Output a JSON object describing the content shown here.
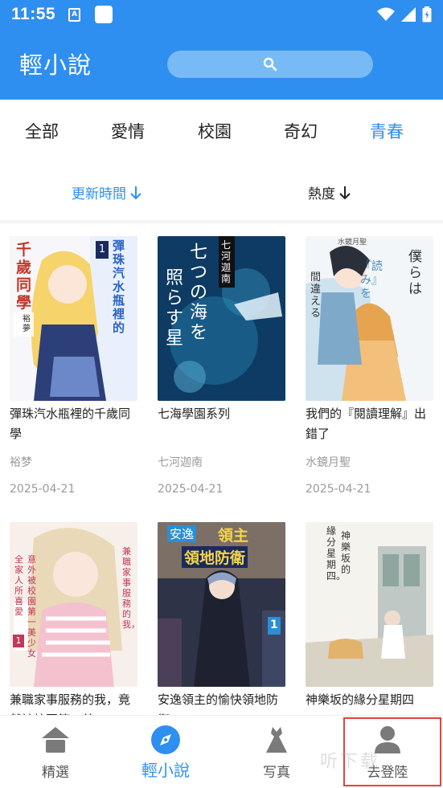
{
  "status_bar": {
    "time": "11:55",
    "notif_icon_letter": "A"
  },
  "app_bar": {
    "title": "輕小說",
    "search_icon": "search-icon"
  },
  "categories": [
    {
      "label": "全部",
      "active": false
    },
    {
      "label": "愛情",
      "active": false
    },
    {
      "label": "校園",
      "active": false
    },
    {
      "label": "奇幻",
      "active": false
    },
    {
      "label": "青春",
      "active": true
    }
  ],
  "sort": {
    "update_time_label": "更新時間",
    "heat_label": "熱度",
    "active_sort": "update_time"
  },
  "books": [
    {
      "title": "彈珠汽水瓶裡的千歲同學",
      "author": "裕梦",
      "date": "2025-04-21"
    },
    {
      "title": "七海學園系列",
      "author": "七河迦南",
      "date": "2025-04-21"
    },
    {
      "title": "我們的『閱讀理解』出錯了",
      "author": "水鏡月聖",
      "date": "2025-04-21"
    },
    {
      "title": "兼職家事服務的我，竟然被校園第一美",
      "author": "",
      "date": ""
    },
    {
      "title": "安逸領主的愉快領地防衛",
      "author": "",
      "date": ""
    },
    {
      "title": "神樂坂的緣分星期四",
      "author": "",
      "date": ""
    }
  ],
  "covers": {
    "c1": {
      "vert_text_1": "彈珠汽水瓶裡的",
      "vert_text_2": "千歲同學",
      "badge": "1",
      "author_tag": "裕夢"
    },
    "c2": {
      "band": "七河迦南",
      "vert_text_1": "七つの海を",
      "vert_text_2": "照らす星"
    },
    "c3": {
      "vert_text_1": "僕らは",
      "vert_text_2": "『読み』を",
      "vert_text_3": "間違える",
      "top_tag": "水鏡月聖"
    },
    "c4": {
      "vert_text_1": "兼職家事服務的我，",
      "vert_text_2": "意外被校園第一美少女",
      "vert_text_3": "全家人所喜愛",
      "badge": "1"
    },
    "c5": {
      "title_1": "安逸",
      "title_2": "領主",
      "title_3": "領地防衛",
      "badge": "1"
    },
    "c6": {
      "vert_text_1": "神樂坂的",
      "vert_text_2": "緣分星期四。"
    }
  },
  "bottom_nav": [
    {
      "label": "精選",
      "icon": "home-icon",
      "active": false
    },
    {
      "label": "輕小說",
      "icon": "compass-icon",
      "active": true
    },
    {
      "label": "写真",
      "icon": "dress-icon",
      "active": false
    },
    {
      "label": "去登陸",
      "icon": "user-icon",
      "active": false
    }
  ],
  "watermark": "听下载",
  "colors": {
    "primary": "#2f8ff0",
    "muted": "#9a9a9a",
    "highlight": "#e8413a"
  }
}
